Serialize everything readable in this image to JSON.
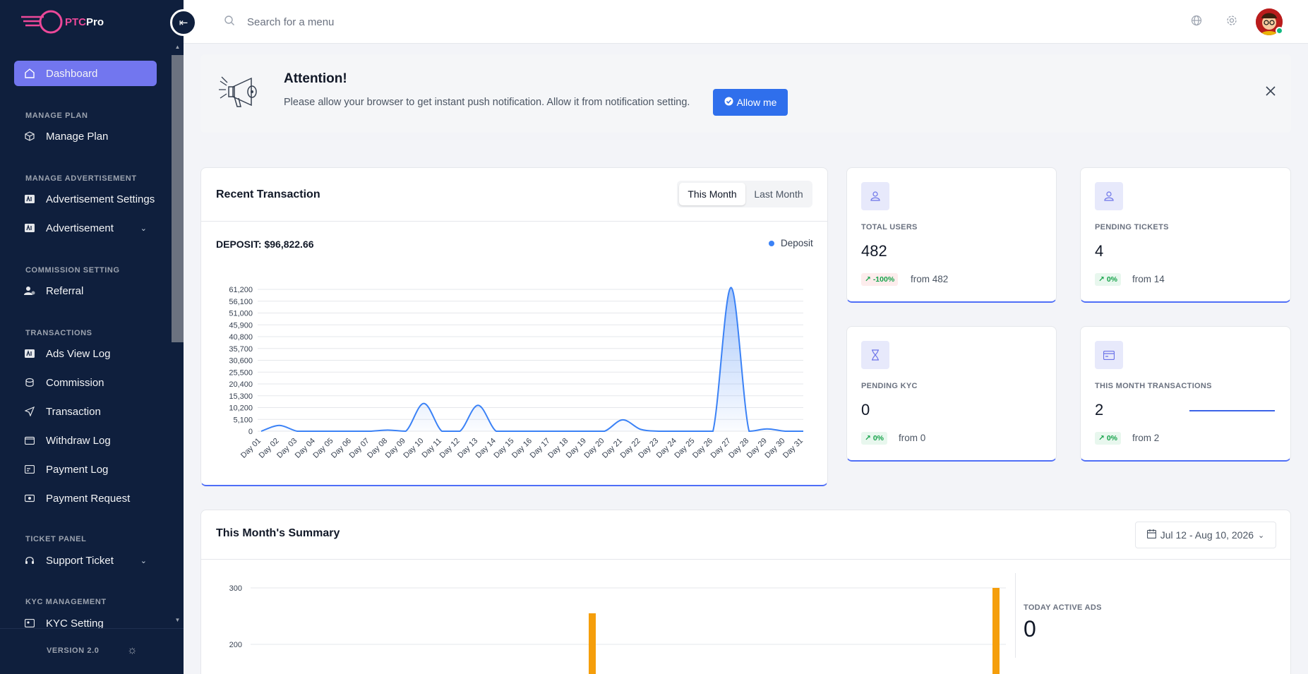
{
  "brand": {
    "prefix": "PTC",
    "suffix": "Pro"
  },
  "sidebar": {
    "active_item": "Dashboard",
    "sections": [
      {
        "heading": "MANAGE PLAN",
        "items": [
          {
            "label": "Manage Plan",
            "icon": "box-icon"
          }
        ]
      },
      {
        "heading": "MANAGE ADVERTISEMENT",
        "items": [
          {
            "label": "Advertisement Settings",
            "icon": "ad-icon"
          },
          {
            "label": "Advertisement",
            "icon": "ad-icon",
            "has_submenu": true
          }
        ]
      },
      {
        "heading": "COMMISSION SETTING",
        "items": [
          {
            "label": "Referral",
            "icon": "users-gear-icon"
          }
        ]
      },
      {
        "heading": "TRANSACTIONS",
        "items": [
          {
            "label": "Ads View Log",
            "icon": "ad-icon"
          },
          {
            "label": "Commission",
            "icon": "coins-icon"
          },
          {
            "label": "Transaction",
            "icon": "send-icon"
          },
          {
            "label": "Withdraw Log",
            "icon": "wallet-icon"
          },
          {
            "label": "Payment Log",
            "icon": "payment-icon"
          },
          {
            "label": "Payment Request",
            "icon": "cash-icon"
          }
        ]
      },
      {
        "heading": "TICKET PANEL",
        "items": [
          {
            "label": "Support Ticket",
            "icon": "headset-icon",
            "has_submenu": true
          }
        ]
      },
      {
        "heading": "KYC MANAGEMENT",
        "items": [
          {
            "label": "KYC Setting",
            "icon": "id-card-icon"
          }
        ]
      }
    ],
    "version": "VERSION 2.0"
  },
  "topbar": {
    "search_placeholder": "Search for a menu"
  },
  "banner": {
    "title": "Attention!",
    "text": "Please allow your browser to get instant push notification. Allow it from notification setting.",
    "button": "Allow me"
  },
  "recent_transaction": {
    "title": "Recent Transaction",
    "tabs": [
      "This Month",
      "Last Month"
    ],
    "active_tab": "This Month",
    "deposit_label": "DEPOSIT: $96,822.66"
  },
  "stats": [
    {
      "label": "TOTAL USERS",
      "value": "482",
      "change": "-100%",
      "from": "from 482",
      "icon": "user-icon"
    },
    {
      "label": "PENDING TICKETS",
      "value": "4",
      "change": "0%",
      "from": "from 14",
      "icon": "user-icon"
    },
    {
      "label": "PENDING KYC",
      "value": "0",
      "change": "0%",
      "from": "from 0",
      "icon": "hourglass-icon"
    },
    {
      "label": "THIS MONTH TRANSACTIONS",
      "value": "2",
      "change": "0%",
      "from": "from 2",
      "icon": "card-icon"
    }
  ],
  "summary": {
    "title": "This Month's Summary",
    "date_range": "Jul 12 - Aug 10, 2026",
    "today_active_ads_label": "TODAY ACTIVE ADS",
    "today_active_ads_value": "0"
  },
  "chart_data": [
    {
      "type": "area",
      "title": "",
      "series": [
        {
          "name": "Deposit",
          "values": [
            0,
            2500,
            0,
            0,
            0,
            0,
            0,
            500,
            0,
            12000,
            0,
            0,
            11200,
            0,
            0,
            0,
            0,
            0,
            0,
            0,
            4900,
            800,
            0,
            0,
            0,
            0,
            62000,
            0,
            1000,
            0,
            0
          ]
        }
      ],
      "categories": [
        "Day 01",
        "Day 02",
        "Day 03",
        "Day 04",
        "Day 05",
        "Day 06",
        "Day 07",
        "Day 08",
        "Day 09",
        "Day 10",
        "Day 11",
        "Day 12",
        "Day 13",
        "Day 14",
        "Day 15",
        "Day 16",
        "Day 17",
        "Day 18",
        "Day 19",
        "Day 20",
        "Day 21",
        "Day 22",
        "Day 23",
        "Day 24",
        "Day 25",
        "Day 26",
        "Day 27",
        "Day 28",
        "Day 29",
        "Day 30",
        "Day 31"
      ],
      "y_ticks": [
        "0",
        "5,100",
        "10,200",
        "15,300",
        "20,400",
        "25,500",
        "30,600",
        "35,700",
        "40,800",
        "45,900",
        "51,000",
        "56,100",
        "61,200"
      ],
      "ylim": [
        0,
        61200
      ],
      "color": "#3b82f6",
      "grid": true,
      "legend": "top-right"
    },
    {
      "type": "bar",
      "title": "",
      "y_ticks": [
        "300",
        "200"
      ],
      "ylim": [
        100,
        300
      ],
      "bar_values": [
        255,
        300
      ],
      "color": "#f59e0b"
    }
  ]
}
